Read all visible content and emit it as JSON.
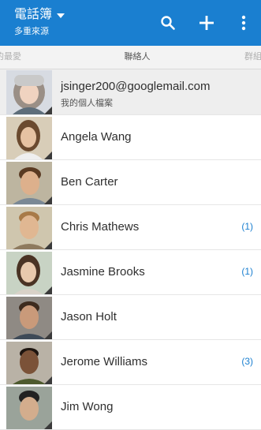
{
  "appbar": {
    "title": "電話簿",
    "subtitle": "多重來源",
    "bg_color": "#1a7fd0",
    "icons": [
      "search-icon",
      "add-icon",
      "more-vert-icon"
    ]
  },
  "tabs": {
    "left": "的最愛",
    "center": "聯絡人",
    "right": "群組"
  },
  "me": {
    "email": "jsinger200@googlemail.com",
    "subtitle": "我的個人檔案"
  },
  "contacts": [
    {
      "name": "Angela Wang",
      "count": ""
    },
    {
      "name": "Ben Carter",
      "count": ""
    },
    {
      "name": "Chris Mathews",
      "count": "(1)"
    },
    {
      "name": "Jasmine Brooks",
      "count": "(1)"
    },
    {
      "name": "Jason Holt",
      "count": ""
    },
    {
      "name": "Jerome Williams",
      "count": "(3)"
    },
    {
      "name": "Jim Wong",
      "count": ""
    }
  ]
}
